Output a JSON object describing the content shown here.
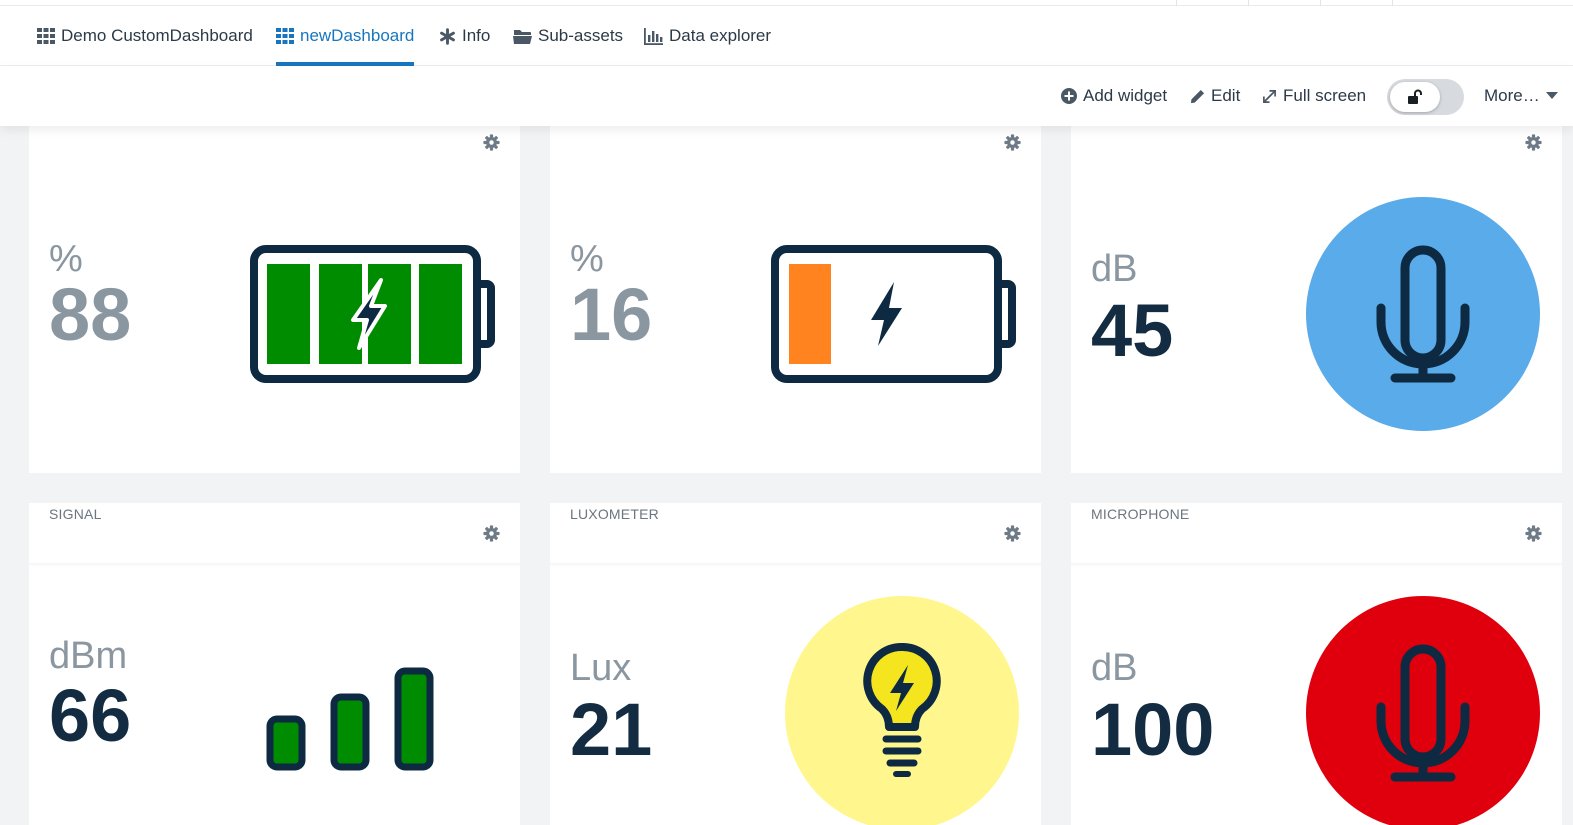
{
  "tabs": [
    {
      "label": "Demo CustomDashboard",
      "icon": "grid-icon",
      "active": false
    },
    {
      "label": "newDashboard",
      "icon": "grid-icon",
      "active": true
    },
    {
      "label": "Info",
      "icon": "asterisk-icon",
      "active": false
    },
    {
      "label": "Sub-assets",
      "icon": "folder-icon",
      "active": false
    },
    {
      "label": "Data explorer",
      "icon": "bar-chart-icon",
      "active": false
    }
  ],
  "actions": {
    "add_widget": "Add widget",
    "edit": "Edit",
    "full_screen": "Full screen",
    "more": "More…",
    "lock_state": "unlocked"
  },
  "widgets": [
    {
      "title": "",
      "unit": "%",
      "value": "88",
      "visual": "battery",
      "level": 0.88,
      "fill_color": "#008c00"
    },
    {
      "title": "",
      "unit": "%",
      "value": "16",
      "visual": "battery",
      "level": 0.16,
      "fill_color": "#ff8420"
    },
    {
      "title": "",
      "unit": "dB",
      "value": "45",
      "visual": "microphone",
      "circle_color": "#5aabea"
    },
    {
      "title": "SIGNAL",
      "unit": "dBm",
      "value": "66",
      "visual": "signal-bars",
      "bars_lit": 3,
      "fill_color": "#008c00"
    },
    {
      "title": "LUXOMETER",
      "unit": "Lux",
      "value": "21",
      "visual": "light-bulb",
      "circle_color": "#fff78d",
      "bulb_color": "#f5e51e"
    },
    {
      "title": "MICROPHONE",
      "unit": "dB",
      "value": "100",
      "visual": "microphone",
      "circle_color": "#e0000d"
    }
  ],
  "colors": {
    "accent": "#1776bf",
    "icon_dark": "#0d2a42",
    "text_grey": "#8a96a0"
  }
}
